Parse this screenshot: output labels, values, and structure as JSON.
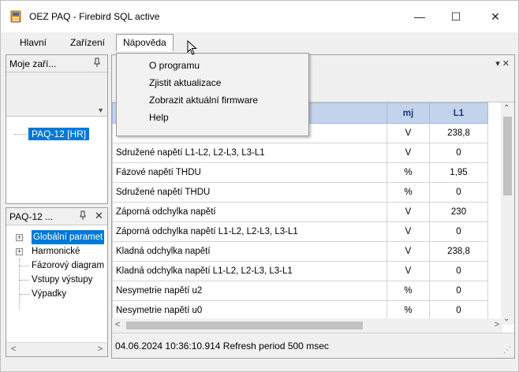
{
  "window": {
    "title": "OEZ PAQ - Firebird SQL active",
    "controls": {
      "minimize": "—",
      "maximize": "☐",
      "close": "✕"
    }
  },
  "menu": {
    "items": [
      "Hlavní",
      "Zařízení",
      "Nápověda"
    ],
    "open_menu": "Nápověda",
    "dropdown": [
      "O programu",
      "Zjistit aktualizace",
      "Zobrazit aktuální firmware",
      "Help"
    ]
  },
  "devices_panel": {
    "title": "Moje zaří...",
    "pin": "ᚖ",
    "device": "PAQ-12 [HR]"
  },
  "tree_panel": {
    "title": "PAQ-12 ...",
    "pin": "ᚖ",
    "close": "✕",
    "items": [
      {
        "label": "Globální paramet",
        "expander": "+",
        "selected": true
      },
      {
        "label": "Harmonické",
        "expander": "+",
        "selected": false
      },
      {
        "label": "Fázorový diagram",
        "expander": "",
        "selected": false
      },
      {
        "label": "Vstupy výstupy",
        "expander": "",
        "selected": false
      },
      {
        "label": "Výpadky",
        "expander": "",
        "selected": false
      }
    ],
    "scroll_left": "<",
    "scroll_right": ">"
  },
  "main_panel": {
    "tools": "▾ ✕",
    "table": {
      "columns": [
        "",
        "mj",
        "L1"
      ],
      "rows": [
        {
          "name": "",
          "unit": "V",
          "l1": "238,8"
        },
        {
          "name": "Sdružené napětí L1-L2, L2-L3, L3-L1",
          "unit": "V",
          "l1": "0"
        },
        {
          "name": "Fázové napětí THDU",
          "unit": "%",
          "l1": "1,95"
        },
        {
          "name": "Sdružené napětí THDU",
          "unit": "%",
          "l1": "0"
        },
        {
          "name": "Záporná odchylka napětí",
          "unit": "V",
          "l1": "230"
        },
        {
          "name": "Záporná odchylka napětí L1-L2, L2-L3, L3-L1",
          "unit": "V",
          "l1": "0"
        },
        {
          "name": "Kladná odchylka napětí",
          "unit": "V",
          "l1": "238,8"
        },
        {
          "name": "Kladná odchylka napětí L1-L2, L2-L3, L3-L1",
          "unit": "V",
          "l1": "0"
        },
        {
          "name": "Nesymetrie napětí u2",
          "unit": "%",
          "l1": "0"
        },
        {
          "name": "Nesymetrie napětí u0",
          "unit": "%",
          "l1": "0"
        }
      ]
    },
    "status": "04.06.2024 10:36:10.914  Refresh period 500 msec"
  },
  "colors": {
    "selection": "#0078d7",
    "header_bg": "#c3d3ec",
    "header_text": "#1a3a7c"
  }
}
